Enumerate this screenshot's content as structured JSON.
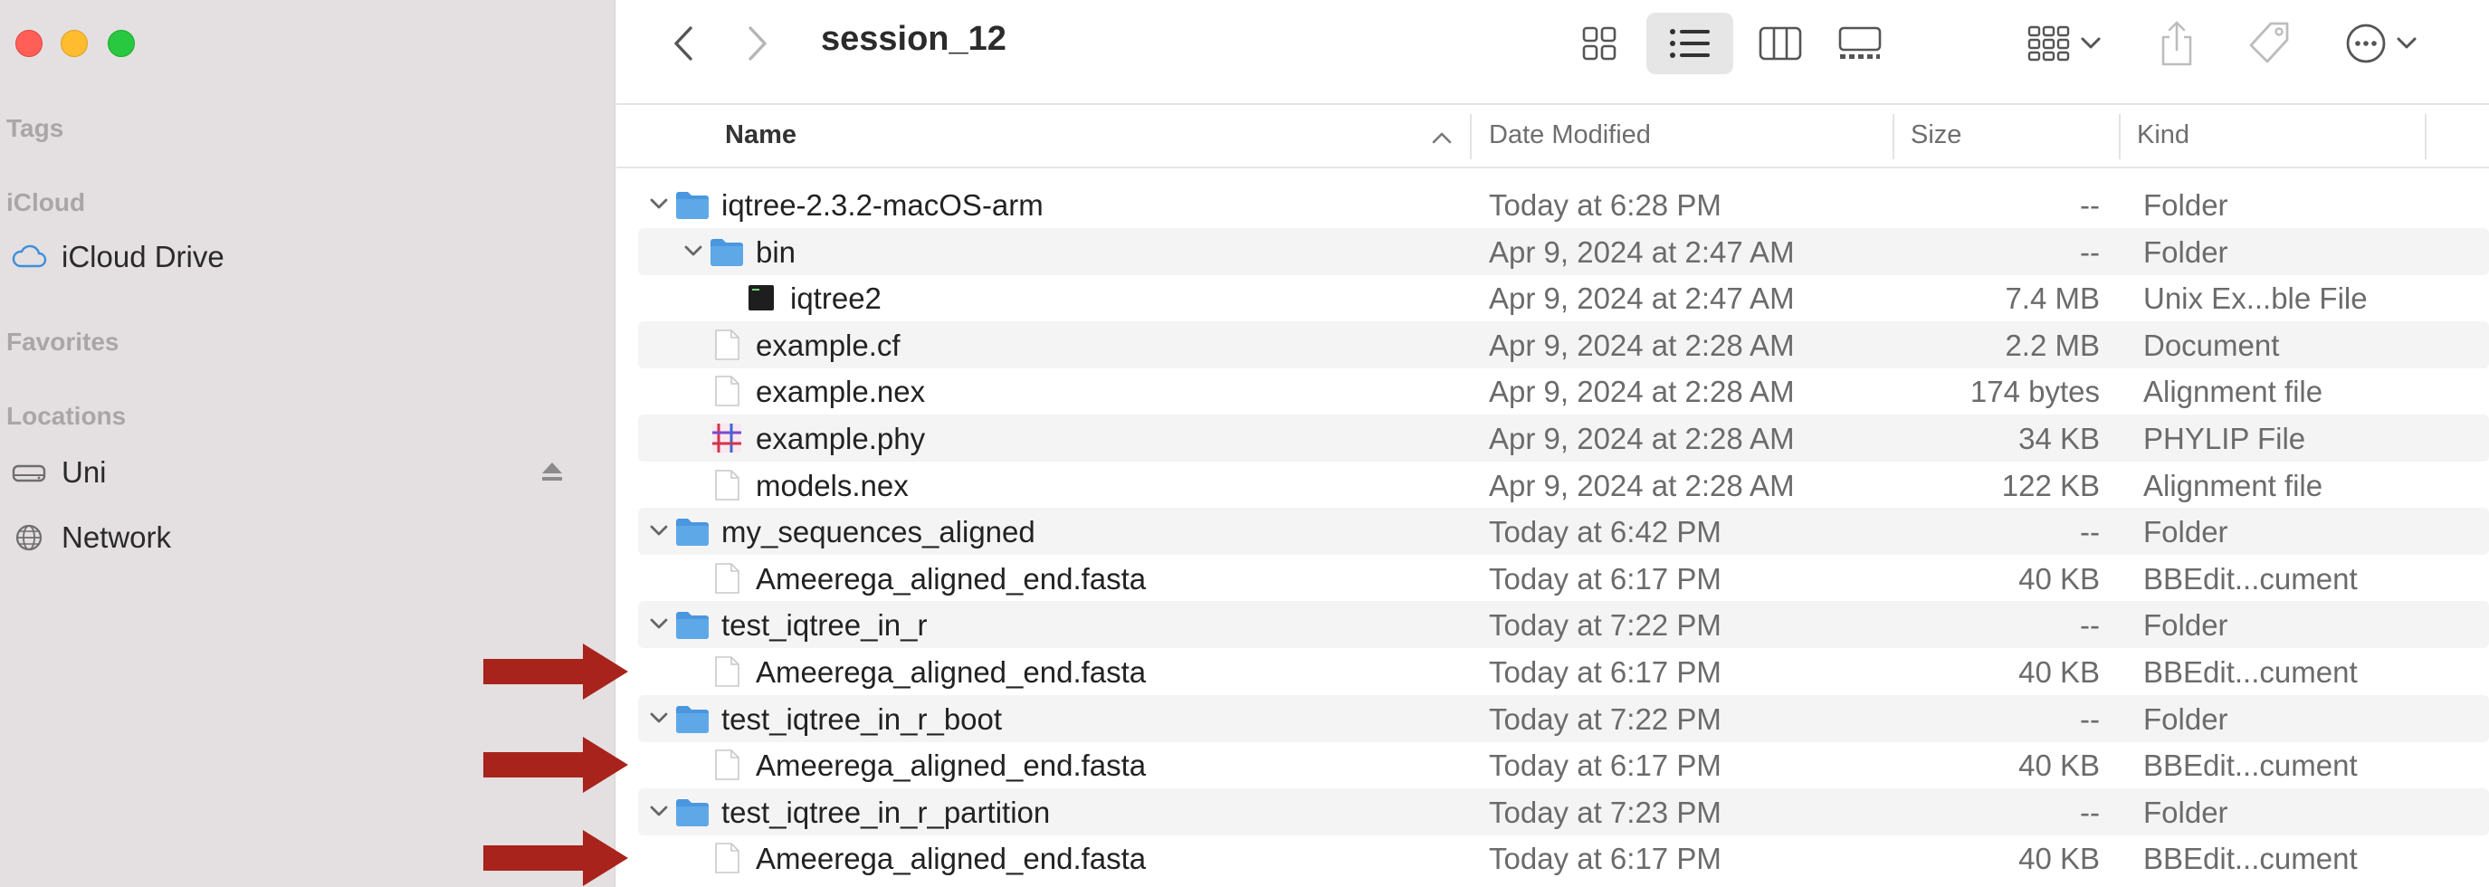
{
  "window": {
    "title": "session_12"
  },
  "sidebar": {
    "sections": {
      "tags": "Tags",
      "icloud": "iCloud",
      "favorites": "Favorites",
      "locations": "Locations"
    },
    "items": {
      "icloud_drive": "iCloud Drive",
      "uni": "Uni",
      "network": "Network"
    }
  },
  "columns": {
    "name": "Name",
    "date": "Date Modified",
    "size": "Size",
    "kind": "Kind"
  },
  "rows": [
    {
      "name": "iqtree-2.3.2-macOS-arm",
      "date": "Today at 6:28 PM",
      "size": "--",
      "kind": "Folder",
      "icon": "folder-icon",
      "level": 0,
      "expanded": true
    },
    {
      "name": "bin",
      "date": "Apr 9, 2024 at 2:47 AM",
      "size": "--",
      "kind": "Folder",
      "icon": "folder-icon",
      "level": 1,
      "expanded": true
    },
    {
      "name": "iqtree2",
      "date": "Apr 9, 2024 at 2:47 AM",
      "size": "7.4 MB",
      "kind": "Unix Ex...ble File",
      "icon": "terminal-exec-icon",
      "level": 2
    },
    {
      "name": "example.cf",
      "date": "Apr 9, 2024 at 2:28 AM",
      "size": "2.2 MB",
      "kind": "Document",
      "icon": "document-icon",
      "level": 1
    },
    {
      "name": "example.nex",
      "date": "Apr 9, 2024 at 2:28 AM",
      "size": "174 bytes",
      "kind": "Alignment file",
      "icon": "document-icon",
      "level": 1
    },
    {
      "name": "example.phy",
      "date": "Apr 9, 2024 at 2:28 AM",
      "size": "34 KB",
      "kind": "PHYLIP File",
      "icon": "phylip-file-icon",
      "level": 1
    },
    {
      "name": "models.nex",
      "date": "Apr 9, 2024 at 2:28 AM",
      "size": "122 KB",
      "kind": "Alignment file",
      "icon": "document-icon",
      "level": 1
    },
    {
      "name": "my_sequences_aligned",
      "date": "Today at 6:42 PM",
      "size": "--",
      "kind": "Folder",
      "icon": "folder-icon",
      "level": 0,
      "expanded": true
    },
    {
      "name": "Ameerega_aligned_end.fasta",
      "date": "Today at 6:17 PM",
      "size": "40 KB",
      "kind": "BBEdit...cument",
      "icon": "document-icon",
      "level": 1
    },
    {
      "name": "test_iqtree_in_r",
      "date": "Today at 7:22 PM",
      "size": "--",
      "kind": "Folder",
      "icon": "folder-icon",
      "level": 0,
      "expanded": true
    },
    {
      "name": "Ameerega_aligned_end.fasta",
      "date": "Today at 6:17 PM",
      "size": "40 KB",
      "kind": "BBEdit...cument",
      "icon": "document-icon",
      "level": 1,
      "arrow": true
    },
    {
      "name": "test_iqtree_in_r_boot",
      "date": "Today at 7:22 PM",
      "size": "--",
      "kind": "Folder",
      "icon": "folder-icon",
      "level": 0,
      "expanded": true
    },
    {
      "name": "Ameerega_aligned_end.fasta",
      "date": "Today at 6:17 PM",
      "size": "40 KB",
      "kind": "BBEdit...cument",
      "icon": "document-icon",
      "level": 1,
      "arrow": true
    },
    {
      "name": "test_iqtree_in_r_partition",
      "date": "Today at 7:23 PM",
      "size": "--",
      "kind": "Folder",
      "icon": "folder-icon",
      "level": 0,
      "expanded": true
    },
    {
      "name": "Ameerega_aligned_end.fasta",
      "date": "Today at 6:17 PM",
      "size": "40 KB",
      "kind": "BBEdit...cument",
      "icon": "document-icon",
      "level": 1,
      "arrow": true
    }
  ],
  "colors": {
    "sidebar_bg": "#e4dfe1",
    "folder_blue": "#5fa8e8",
    "arrow_red": "#a8231c",
    "row_alt": "#f4f4f4"
  }
}
